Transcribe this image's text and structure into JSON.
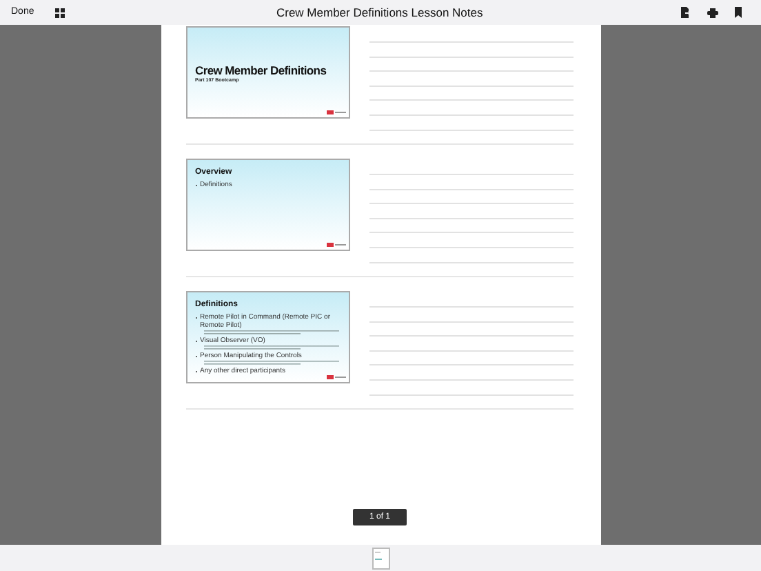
{
  "toolbar": {
    "done": "Done",
    "title": "Crew Member Definitions Lesson Notes"
  },
  "slides": [
    {
      "kind": "title",
      "title": "Crew Member Definitions",
      "subtitle": "Part 107 Bootcamp"
    },
    {
      "kind": "bullets",
      "title": "Overview",
      "bullets": [
        {
          "text": "Definitions",
          "detail": false
        }
      ]
    },
    {
      "kind": "bullets",
      "title": "Definitions",
      "bullets": [
        {
          "text": "Remote Pilot in Command (Remote PIC or Remote Pilot)",
          "detail": true
        },
        {
          "text": "Visual Observer (VO)",
          "detail": true
        },
        {
          "text": "Person Manipulating the Controls",
          "detail": true
        },
        {
          "text": "Any other direct participants",
          "detail": false
        }
      ]
    }
  ],
  "page_indicator": "1 of 1"
}
